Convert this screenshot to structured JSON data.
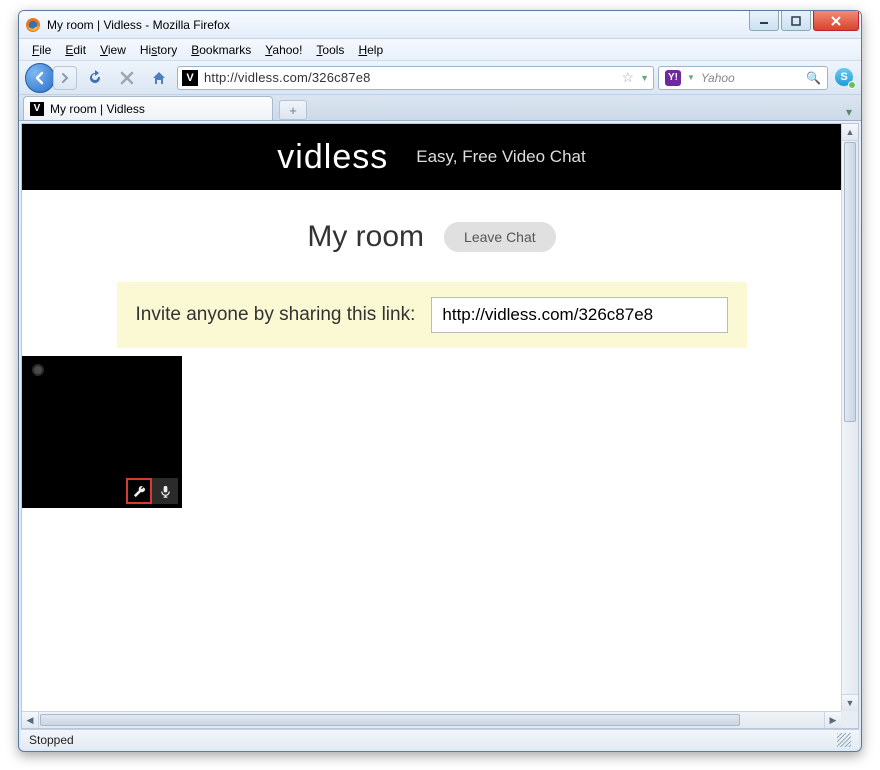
{
  "window": {
    "title": "My room | Vidless - Mozilla Firefox"
  },
  "menu": {
    "file": "File",
    "edit": "Edit",
    "view": "View",
    "history": "History",
    "bookmarks": "Bookmarks",
    "yahoo": "Yahoo!",
    "tools": "Tools",
    "help": "Help"
  },
  "navbar": {
    "url": "http://vidless.com/326c87e8",
    "search_placeholder": "Yahoo",
    "favicon_letter": "V",
    "search_engine_letter": "Y!"
  },
  "tab": {
    "title": "My room | Vidless",
    "newtab_symbol": "+"
  },
  "vidless": {
    "logo_text": "vidless",
    "tagline": "Easy, Free Video Chat",
    "room_title": "My room",
    "leave_label": "Leave Chat",
    "invite_text": "Invite anyone by sharing this link:",
    "invite_url": "http://vidless.com/326c87e8"
  },
  "status": {
    "text": "Stopped"
  }
}
